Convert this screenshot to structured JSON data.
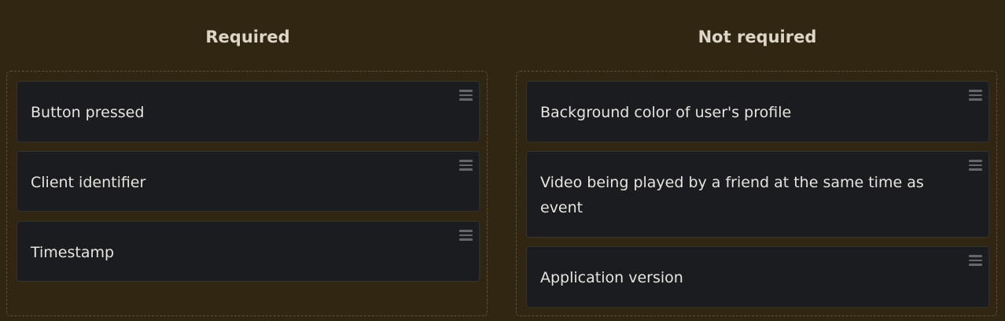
{
  "columns": [
    {
      "title": "Required",
      "items": [
        "Button pressed",
        "Client identifier",
        "Timestamp"
      ]
    },
    {
      "title": "Not required",
      "items": [
        "Background color of user's profile",
        "Video being played by a friend at the same time as event",
        "Application version"
      ]
    }
  ],
  "icons": {
    "drag_handle": "drag-handle-icon"
  },
  "colors": {
    "background": "#302612",
    "card": "#1b1c1f",
    "text": "#e6e4df",
    "dropzone_border": "#5c5238"
  }
}
